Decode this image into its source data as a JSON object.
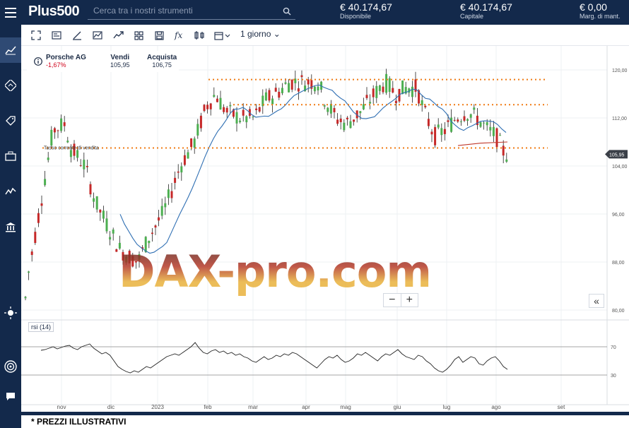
{
  "header": {
    "logo": "Plus500",
    "search_placeholder": "Cerca tra i nostri strumenti",
    "stats": [
      {
        "value": "€ 40.174,67",
        "label": "Disponibile"
      },
      {
        "value": "€ 40.174,67",
        "label": "Capitale"
      },
      {
        "value": "€ 0,00",
        "label": "Marg. di mant."
      }
    ]
  },
  "toolbar": {
    "period": "1 giorno"
  },
  "instrument": {
    "name": "Porsche AG",
    "change": "-1,67%",
    "sell_label": "Vendi",
    "sell_value": "105,95",
    "buy_label": "Acquista",
    "buy_value": "106,75"
  },
  "chart_data": {
    "type": "candlestick",
    "price_axis_ticks": [
      "120,00",
      "112,00",
      "104,00",
      "96,00",
      "88,00",
      "80,00"
    ],
    "current_price_label": "105,95",
    "x_tick_labels": [
      "nov",
      "dic",
      "2023",
      "feb",
      "mar",
      "apr",
      "mag",
      "giu",
      "lug",
      "ago",
      "set"
    ],
    "annotation": "Tasso corrente di vendita",
    "horizontal_levels": [
      118.4,
      114.2,
      107.0
    ],
    "watermark": "DAX-pro.com",
    "rsi": {
      "label": "rsi (14)",
      "ticks": [
        "70",
        "30"
      ],
      "values": [
        65,
        66,
        68,
        70,
        67,
        69,
        71,
        72,
        68,
        66,
        70,
        72,
        74,
        68,
        64,
        60,
        62,
        58,
        50,
        42,
        38,
        35,
        33,
        36,
        34,
        38,
        42,
        40,
        44,
        48,
        52,
        56,
        58,
        60,
        58,
        62,
        66,
        70,
        76,
        68,
        62,
        60,
        64,
        66,
        62,
        64,
        60,
        62,
        58,
        60,
        56,
        54,
        50,
        48,
        52,
        56,
        52,
        54,
        58,
        56,
        60,
        58,
        62,
        60,
        56,
        52,
        48,
        44,
        40,
        46,
        52,
        56,
        54,
        58,
        52,
        48,
        50,
        54,
        60,
        58,
        62,
        58,
        54,
        50,
        56,
        60,
        58,
        62,
        66,
        60,
        56,
        54,
        52,
        58,
        56,
        50,
        46,
        40,
        36,
        34,
        38,
        44,
        52,
        56,
        48,
        52,
        56,
        54,
        46,
        44,
        50,
        54,
        56,
        50,
        42,
        38
      ]
    }
  },
  "footnote": "* PREZZI ILLUSTRATIVI"
}
